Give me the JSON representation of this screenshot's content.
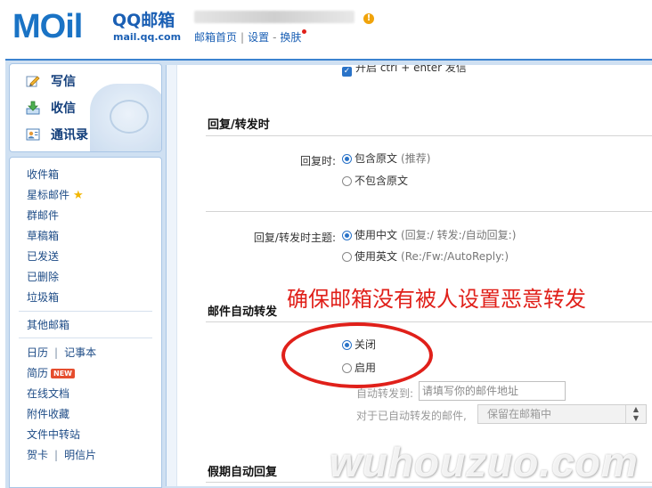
{
  "header": {
    "brand": "QQ邮箱",
    "domain": "mail.qq.com",
    "logo_text": "MOil",
    "warning_glyph": "!",
    "links": [
      "邮箱首页",
      "设置",
      "换肤"
    ]
  },
  "left_actions": [
    {
      "label": "写信",
      "icon": "compose-icon"
    },
    {
      "label": "收信",
      "icon": "inbox-download-icon"
    },
    {
      "label": "通讯录",
      "icon": "contacts-icon"
    }
  ],
  "nav": {
    "folders": [
      "收件箱",
      "星标邮件",
      "群邮件",
      "草稿箱",
      "已发送",
      "已删除",
      "垃圾箱"
    ],
    "other_mail": "其他邮箱",
    "calendar": "日历",
    "notebook": "记事本",
    "resume": "简历",
    "new_badge": "NEW",
    "online_docs": "在线文档",
    "attachments": "附件收藏",
    "file_transfer": "文件中转站",
    "card": "贺卡",
    "postcard": "明信片"
  },
  "settings": {
    "top_checkbox_label": "开启 ctrl + enter 发信",
    "reply_forward": {
      "title": "回复/转发时",
      "reply_label": "回复时:",
      "reply_options": [
        {
          "label": "包含原文",
          "note": "(推荐)",
          "selected": true
        },
        {
          "label": "不包含原文",
          "note": "",
          "selected": false
        }
      ],
      "subject_label": "回复/转发时主题:",
      "subject_options": [
        {
          "label": "使用中文",
          "note": "(回复:/ 转发:/自动回复:)",
          "selected": true
        },
        {
          "label": "使用英文",
          "note": "(Re:/Fw:/AutoReply:)",
          "selected": false
        }
      ]
    },
    "auto_forward": {
      "title": "邮件自动转发",
      "options": [
        {
          "label": "关闭",
          "selected": true
        },
        {
          "label": "启用",
          "selected": false
        }
      ],
      "forward_to_label": "自动转发到:",
      "forward_to_placeholder": "请填写你的邮件地址",
      "forward_to_value": "",
      "after_forward_label": "对于已自动转发的邮件,",
      "after_forward_value": "保留在邮箱中"
    },
    "vacation": {
      "title": "假期自动回复"
    }
  },
  "annotation": "确保邮箱没有被人设置恶意转发",
  "watermark": "wuhouzuo.com",
  "colors": {
    "accent": "#1a73c5",
    "annotation": "#e0201a",
    "frame": "#cfe0f2"
  }
}
